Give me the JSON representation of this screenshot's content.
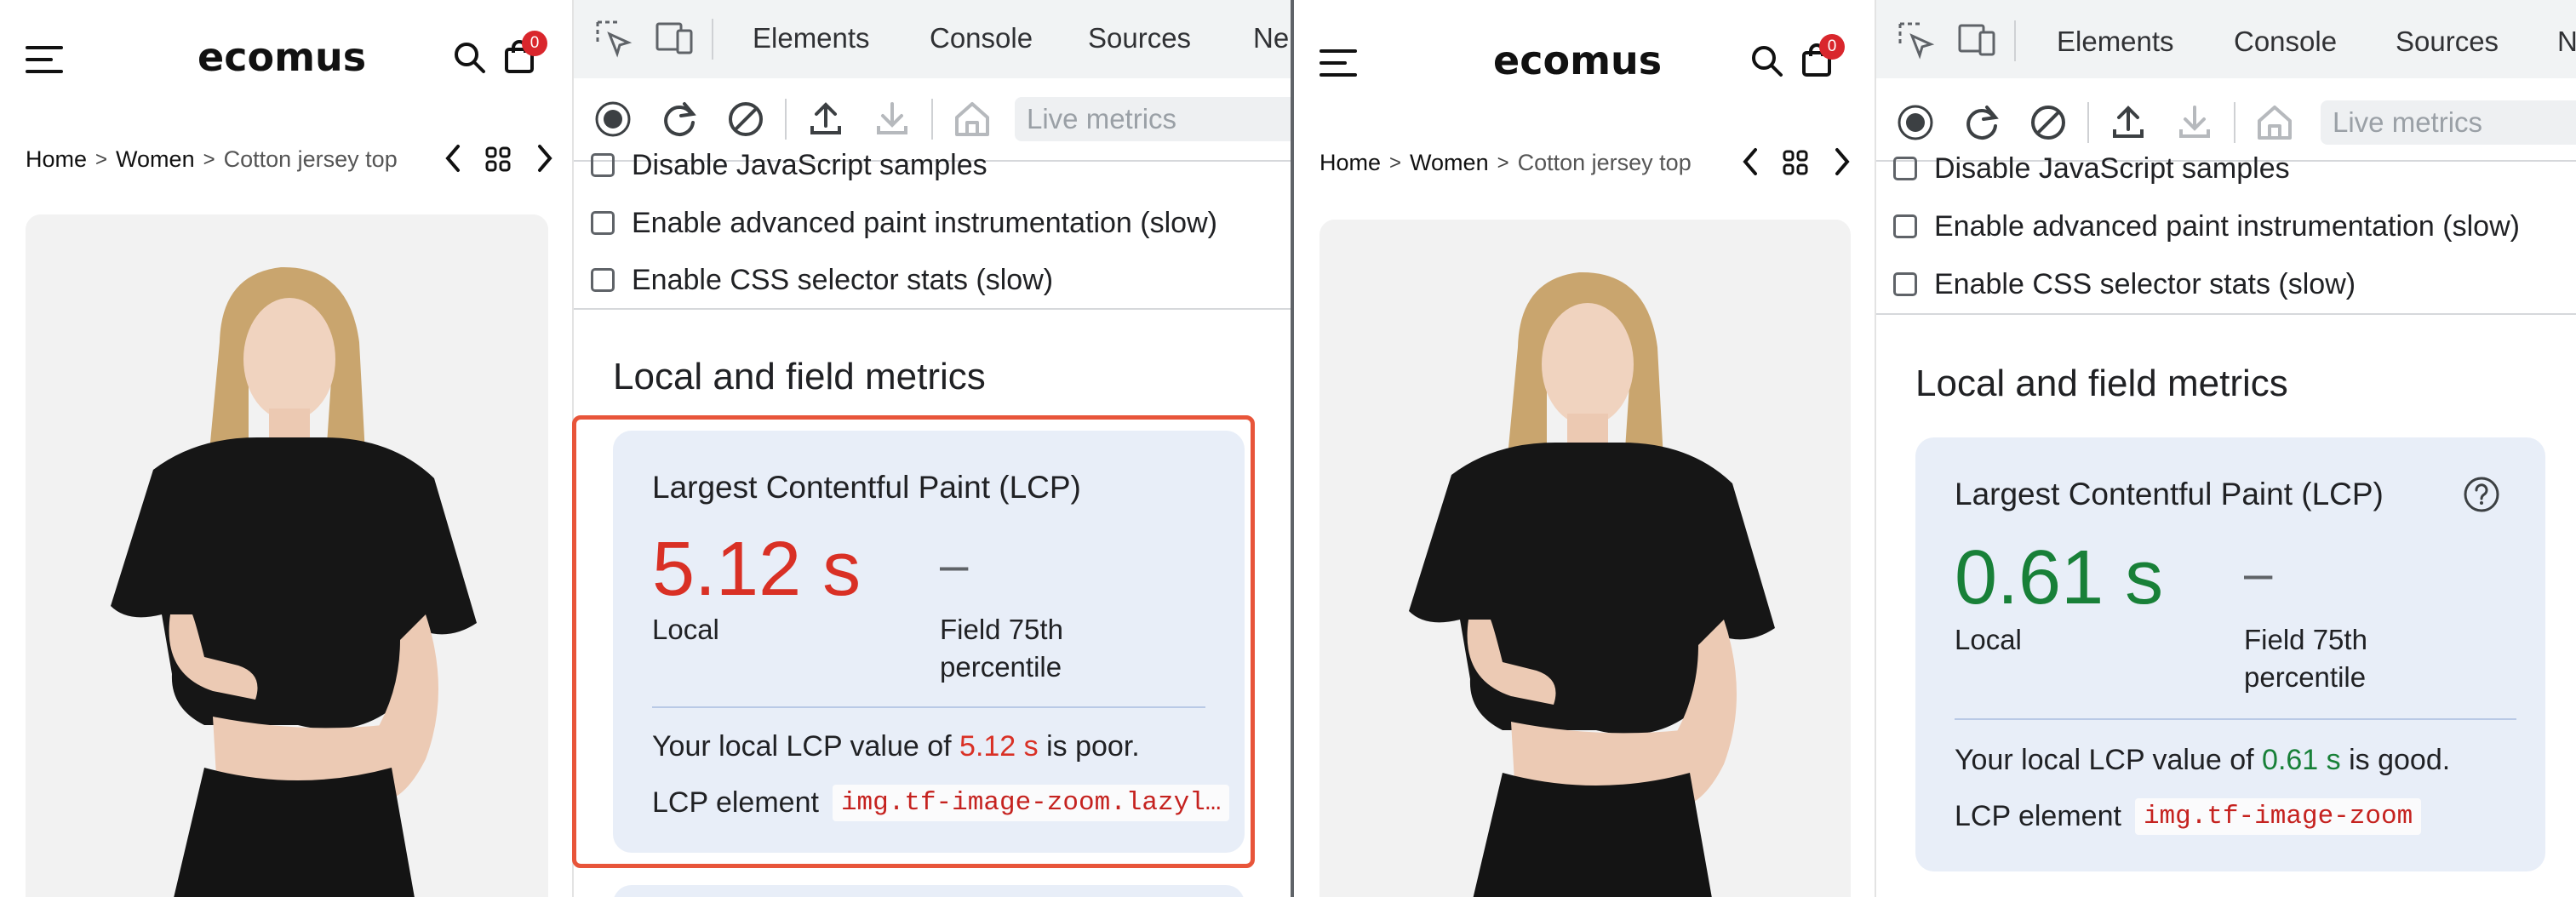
{
  "store": {
    "logo": "ecomus",
    "cart_count": "0",
    "breadcrumb": {
      "home": "Home",
      "category": "Women",
      "current": "Cotton jersey top",
      "separator": ">"
    }
  },
  "devtools": {
    "tabs": [
      "Elements",
      "Console",
      "Sources",
      "Ne"
    ],
    "right_tabs": [
      "Elements",
      "Console",
      "Sources",
      "N"
    ],
    "live_metrics_placeholder": "Live metrics",
    "options": [
      "Disable JavaScript samples",
      "Enable advanced paint instrumentation (slow)",
      "Enable CSS selector stats (slow)"
    ],
    "section_title": "Local and field metrics"
  },
  "before": {
    "card_title": "Largest Contentful Paint (LCP)",
    "local_value": "5.12 s",
    "local_label": "Local",
    "field_value": "–",
    "field_label_1": "Field 75th",
    "field_label_2": "percentile",
    "msg_prefix": "Your local LCP value of",
    "msg_value": "5.12 s",
    "msg_suffix": "is poor.",
    "element_label": "LCP element",
    "element_value": "img.tf-image-zoom.lazyl…",
    "status_color": "#d93025"
  },
  "after": {
    "card_title": "Largest Contentful Paint (LCP)",
    "local_value": "0.61 s",
    "local_label": "Local",
    "field_value": "–",
    "field_label_1": "Field 75th",
    "field_label_2": "percentile",
    "msg_prefix": "Your local LCP value of",
    "msg_value": "0.61 s",
    "msg_suffix": "is good.",
    "element_label": "LCP element",
    "element_value": "img.tf-image-zoom",
    "status_color": "#188038"
  },
  "icons": [
    "menu-icon",
    "search-icon",
    "cart-icon",
    "chevron-left-icon",
    "grid-icon",
    "chevron-right-icon",
    "inspect-icon",
    "device-toolbar-icon",
    "record-icon",
    "reload-icon",
    "clear-icon",
    "upload-icon",
    "download-icon",
    "home-icon",
    "help-icon"
  ]
}
